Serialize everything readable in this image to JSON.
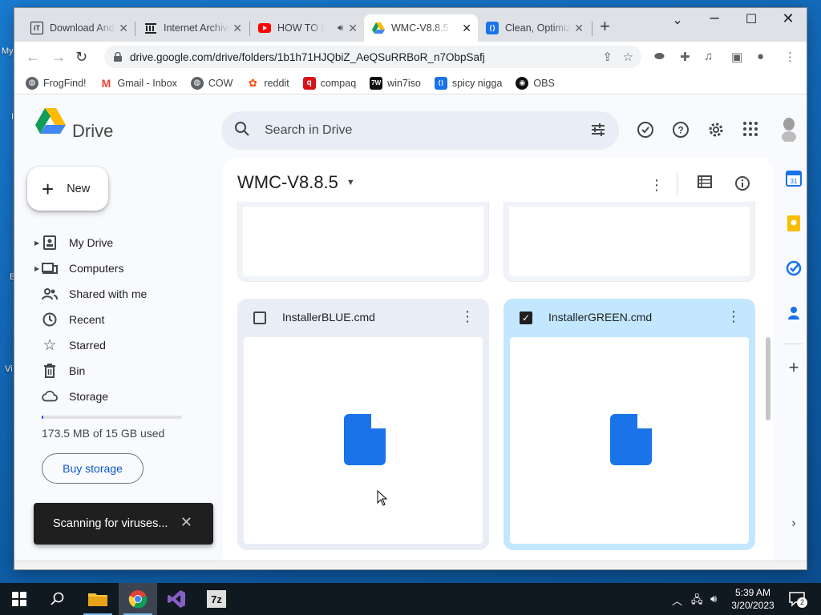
{
  "desktop": {
    "labels": [
      "My",
      "I",
      "E",
      "Vi"
    ]
  },
  "browser": {
    "tabs": [
      {
        "title": "Download And",
        "favicon": "iT"
      },
      {
        "title": "Internet Archive",
        "favicon": "archive-icon"
      },
      {
        "title": "HOW TO F",
        "favicon": "youtube-icon"
      },
      {
        "title": "WMC-V8.8.5 -",
        "favicon": "drive-icon",
        "active": true
      },
      {
        "title": "Clean, Optimiz",
        "favicon": "blue-app-icon"
      }
    ],
    "new_tab": "+",
    "url": "drive.google.com/drive/folders/1b1h71HJQbiZ_AeQSuRRBoR_n7ObpSafj",
    "bookmarks": [
      {
        "label": "FrogFind!",
        "icon": "globe-icon"
      },
      {
        "label": "Gmail - Inbox",
        "icon": "gmail-icon"
      },
      {
        "label": "COW",
        "icon": "globe-icon"
      },
      {
        "label": "reddit",
        "icon": "reddit-icon"
      },
      {
        "label": "compaq",
        "icon": "compaq-icon"
      },
      {
        "label": "win7iso",
        "icon": "7w-icon"
      },
      {
        "label": "spicy nigga",
        "icon": "blue-app-icon"
      },
      {
        "label": "OBS",
        "icon": "github-icon"
      }
    ]
  },
  "drive": {
    "brand": "Drive",
    "search_placeholder": "Search in Drive",
    "new_label": "New",
    "nav": [
      {
        "label": "My Drive",
        "icon": "my-drive-icon",
        "expandable": true
      },
      {
        "label": "Computers",
        "icon": "computers-icon",
        "expandable": true
      },
      {
        "label": "Shared with me",
        "icon": "shared-icon",
        "expandable": false
      },
      {
        "label": "Recent",
        "icon": "clock-icon",
        "expandable": false
      },
      {
        "label": "Starred",
        "icon": "star-icon",
        "expandable": false
      },
      {
        "label": "Bin",
        "icon": "bin-icon",
        "expandable": false
      },
      {
        "label": "Storage",
        "icon": "cloud-icon",
        "expandable": false
      }
    ],
    "storage_used_fraction": 0.012,
    "storage_text": "173.5 MB of 15 GB used",
    "buy_storage": "Buy storage",
    "folder_title": "WMC-V8.8.5",
    "files": [
      {
        "name": "InstallerBLUE.cmd",
        "checked": false
      },
      {
        "name": "InstallerGREEN.cmd",
        "checked": true
      }
    ],
    "toast": "Scanning for viruses..."
  },
  "taskbar": {
    "time": "5:39 AM",
    "date": "3/20/2023",
    "notifications": "2"
  },
  "colors": {
    "accent": "#0b57d0",
    "selected_card": "#c2e7ff",
    "doc_icon": "#1a73e8"
  }
}
